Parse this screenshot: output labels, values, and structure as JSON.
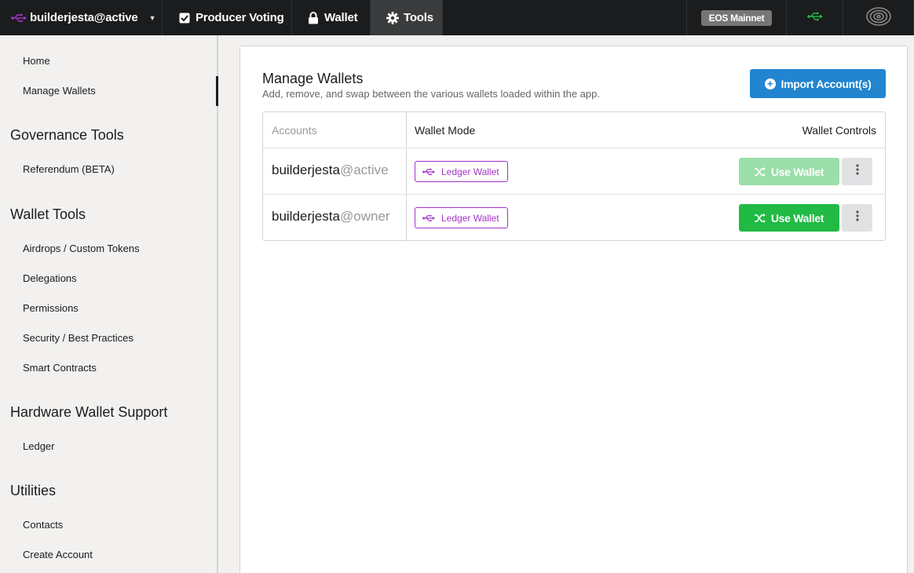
{
  "topbar": {
    "account": "builderjesta@active",
    "tabs": [
      {
        "label": "Producer Voting",
        "icon": "checkbox-icon"
      },
      {
        "label": "Wallet",
        "icon": "lock-icon"
      },
      {
        "label": "Tools",
        "icon": "gear-icon"
      }
    ],
    "network": "EOS Mainnet"
  },
  "sidebar": {
    "links_top": [
      {
        "label": "Home"
      },
      {
        "label": "Manage Wallets",
        "active": true
      }
    ],
    "sections": [
      {
        "header": "Governance Tools",
        "items": [
          "Referendum (BETA)"
        ]
      },
      {
        "header": "Wallet Tools",
        "items": [
          "Airdrops / Custom Tokens",
          "Delegations",
          "Permissions",
          "Security / Best Practices",
          "Smart Contracts"
        ]
      },
      {
        "header": "Hardware Wallet Support",
        "items": [
          "Ledger"
        ]
      },
      {
        "header": "Utilities",
        "items": [
          "Contacts",
          "Create Account"
        ]
      }
    ]
  },
  "main": {
    "title": "Manage Wallets",
    "subtitle": "Add, remove, and swap between the various wallets loaded within the app.",
    "import_button": "Import Account(s)",
    "table": {
      "headers": [
        "Accounts",
        "Wallet Mode",
        "Wallet Controls"
      ],
      "rows": [
        {
          "name": "builderjesta",
          "permission": "@active",
          "mode": "Ledger Wallet",
          "action": "Use Wallet",
          "action_enabled": false
        },
        {
          "name": "builderjesta",
          "permission": "@owner",
          "mode": "Ledger Wallet",
          "action": "Use Wallet",
          "action_enabled": true
        }
      ]
    }
  },
  "colors": {
    "topbar": "#1b1c1d",
    "primary": "#2185d0",
    "success": "#21ba45",
    "ledger": "#a333c8",
    "usb_active": "#21ba45"
  }
}
